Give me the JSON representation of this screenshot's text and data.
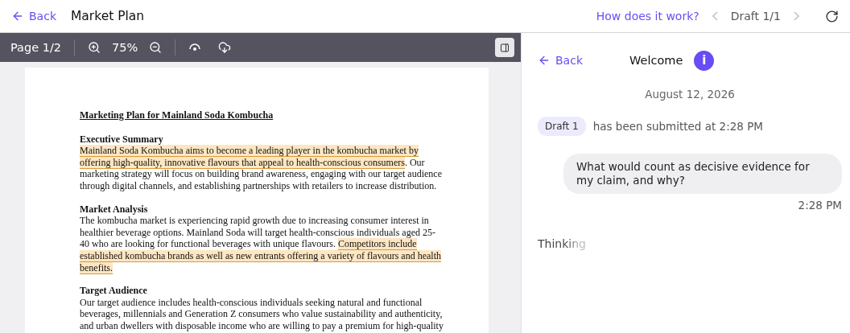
{
  "header": {
    "back": "Back",
    "title": "Market Plan",
    "help_link": "How does it work?",
    "draft_counter": "Draft 1/1",
    "prev_disabled": true,
    "next_disabled": true
  },
  "viewer": {
    "page": "Page 1/2",
    "zoom": "75%",
    "sidebar_open": true,
    "document": {
      "title": "Marketing Plan for Mainland Soda Kombucha",
      "sections": [
        {
          "heading": "Executive Summary",
          "segments": [
            {
              "text": "Mainland Soda Kombucha aims to become a leading player in the kombucha market by offering high-quality, innovative flavours that appeal to health-conscious consumers",
              "highlighted": true
            },
            {
              "text": ". Our marketing strategy will focus on building brand awareness, engaging with our target audience through digital channels, and establishing partnerships with retailers to increase distribution.",
              "highlighted": false
            }
          ]
        },
        {
          "heading": "Market Analysis",
          "segments": [
            {
              "text": "The kombucha market is experiencing rapid growth due to increasing consumer interest in healthier beverage options. Mainland Soda will target health-conscious individuals aged 25-40 who are looking for functional beverages with unique flavours. ",
              "highlighted": false
            },
            {
              "text": "Competitors include established kombucha brands as well as new entrants offering a variety of flavours and health benefits.",
              "highlighted": true
            }
          ]
        },
        {
          "heading": "Target Audience",
          "segments": [
            {
              "text": "Our target audience includes health-conscious individuals seeking natural and functional beverages, millennials and Generation Z consumers who value sustainability and authenticity, and urban dwellers with disposable income who are willing to pay a premium for high-quality",
              "highlighted": false
            }
          ]
        }
      ]
    }
  },
  "chat": {
    "back": "Back",
    "title": "Welcome",
    "info_icon": "i",
    "date": "August 12, 2026",
    "events": [
      {
        "badge": "Draft 1",
        "text": "has been submitted at 2:28 PM"
      }
    ],
    "messages": [
      {
        "text": "What would count as decisive evidence for my claim, and why?",
        "time": "2:28 PM"
      }
    ],
    "status": "Thinking"
  }
}
